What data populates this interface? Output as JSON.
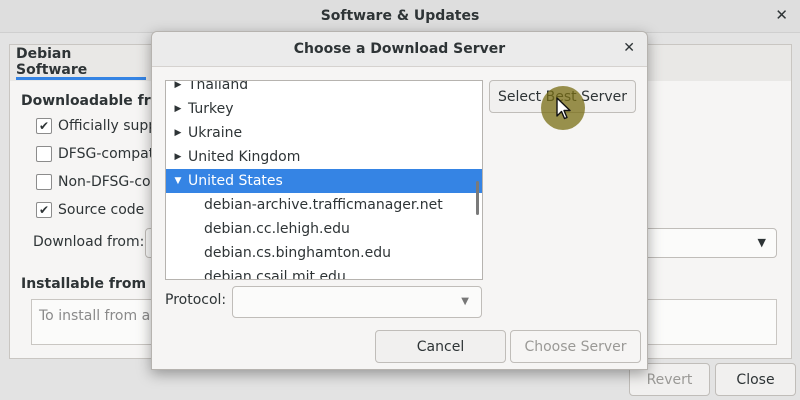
{
  "window": {
    "title": "Software & Updates",
    "close_glyph": "✕"
  },
  "tabs": [
    {
      "label": "Debian Software"
    }
  ],
  "background": {
    "downloadable_heading": "Downloadable from t",
    "checks": [
      {
        "label": "Officially suppo",
        "checked": true
      },
      {
        "label": "DFSG-compati",
        "checked": false
      },
      {
        "label": "Non-DFSG-cor",
        "checked": false
      },
      {
        "label": "Source code",
        "checked": true
      }
    ],
    "download_from_label": "Download from:",
    "cd_heading": "Installable from CD-R",
    "cd_text": "To install from a C",
    "revert_label": "Revert",
    "close_label": "Close"
  },
  "dialog": {
    "title": "Choose a Download Server",
    "close_glyph": "✕",
    "countries": [
      {
        "label": "Thailand",
        "expanded": false
      },
      {
        "label": "Turkey",
        "expanded": false
      },
      {
        "label": "Ukraine",
        "expanded": false
      },
      {
        "label": "United Kingdom",
        "expanded": false
      },
      {
        "label": "United States",
        "expanded": true,
        "selected": true
      }
    ],
    "servers": [
      "debian-archive.trafficmanager.net",
      "debian.cc.lehigh.edu",
      "debian.cs.binghamton.edu",
      "debian.csail.mit.edu"
    ],
    "select_best_label": "Select Best Server",
    "protocol_label": "Protocol:",
    "protocol_value": "",
    "cancel_label": "Cancel",
    "choose_label": "Choose Server"
  },
  "colors": {
    "selection": "#3584e4",
    "cursor_highlight": "#786e14"
  }
}
